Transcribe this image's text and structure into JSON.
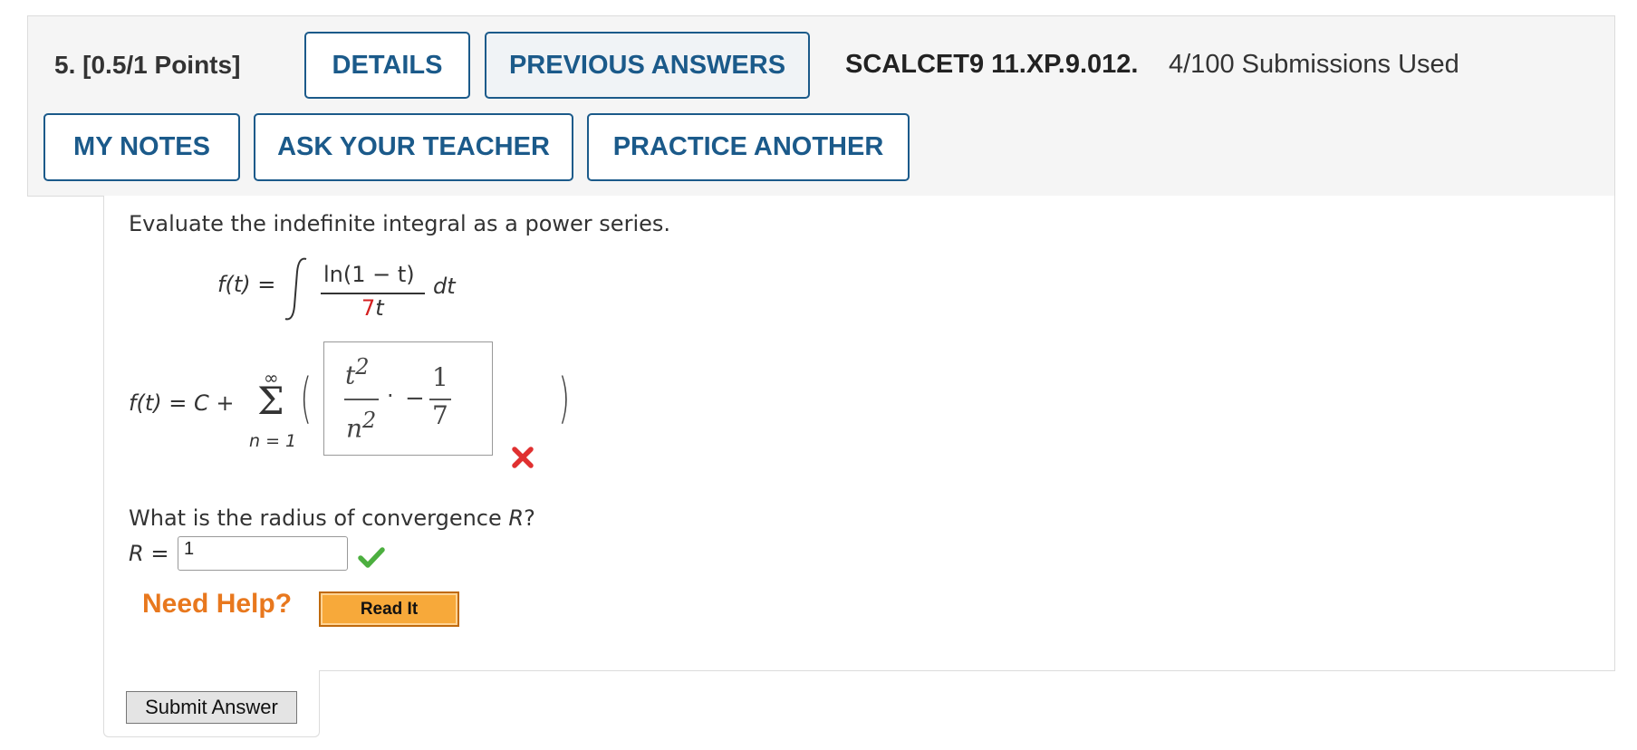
{
  "header": {
    "question_number": "5.",
    "points": "[0.5/1 Points]",
    "details_label": "DETAILS",
    "previous_answers_label": "PREVIOUS ANSWERS",
    "assignment_code": "SCALCET9 11.XP.9.012.",
    "submissions": "4/100 Submissions Used",
    "my_notes_label": "MY NOTES",
    "ask_teacher_label": "ASK YOUR TEACHER",
    "practice_another_label": "PRACTICE ANOTHER",
    "accent_color": "#1b5a8a"
  },
  "question": {
    "prompt": "Evaluate the indefinite integral as a power series.",
    "integral": {
      "lhs": "f(t) =",
      "numerator": "ln(1 − t)",
      "denominator_coefficient": "7",
      "denominator_var": "t",
      "differential": "dt"
    },
    "series": {
      "lhs": "f(t) = C +",
      "sum_upper": "∞",
      "sum_symbol": "Σ",
      "sum_lower": "n = 1",
      "open_paren": "(",
      "close_paren": ")"
    },
    "answer": {
      "num1_base": "t",
      "num1_exp": "2",
      "den1_base": "n",
      "den1_exp": "2",
      "dot": "·",
      "neg": "−",
      "num2": "1",
      "den2": "7",
      "status": "incorrect",
      "status_icon": "x-mark-icon",
      "status_color": "#e03030"
    },
    "radius_prompt_prefix": "What is the radius of convergence ",
    "radius_prompt_var": "R",
    "radius_prompt_suffix": "?",
    "radius_label_var": "R",
    "radius_label_eq": "=",
    "radius_value": "1",
    "radius_status": "correct",
    "radius_status_icon": "check-mark-icon",
    "radius_status_color": "#4caf3f"
  },
  "help": {
    "need_help_label": "Need Help?",
    "read_it_label": "Read It"
  },
  "submit_label": "Submit Answer"
}
